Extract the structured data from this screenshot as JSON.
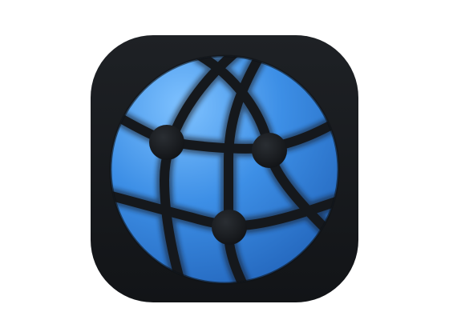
{
  "icon": {
    "name": "network-globe-app-icon",
    "tile_color": "#16191d",
    "globe_color_light": "#7fc2ff",
    "globe_color_mid": "#3d8fe6",
    "globe_color_dark": "#1f5fb5",
    "line_color": "#15181c",
    "node_color": "#1b1e22"
  }
}
